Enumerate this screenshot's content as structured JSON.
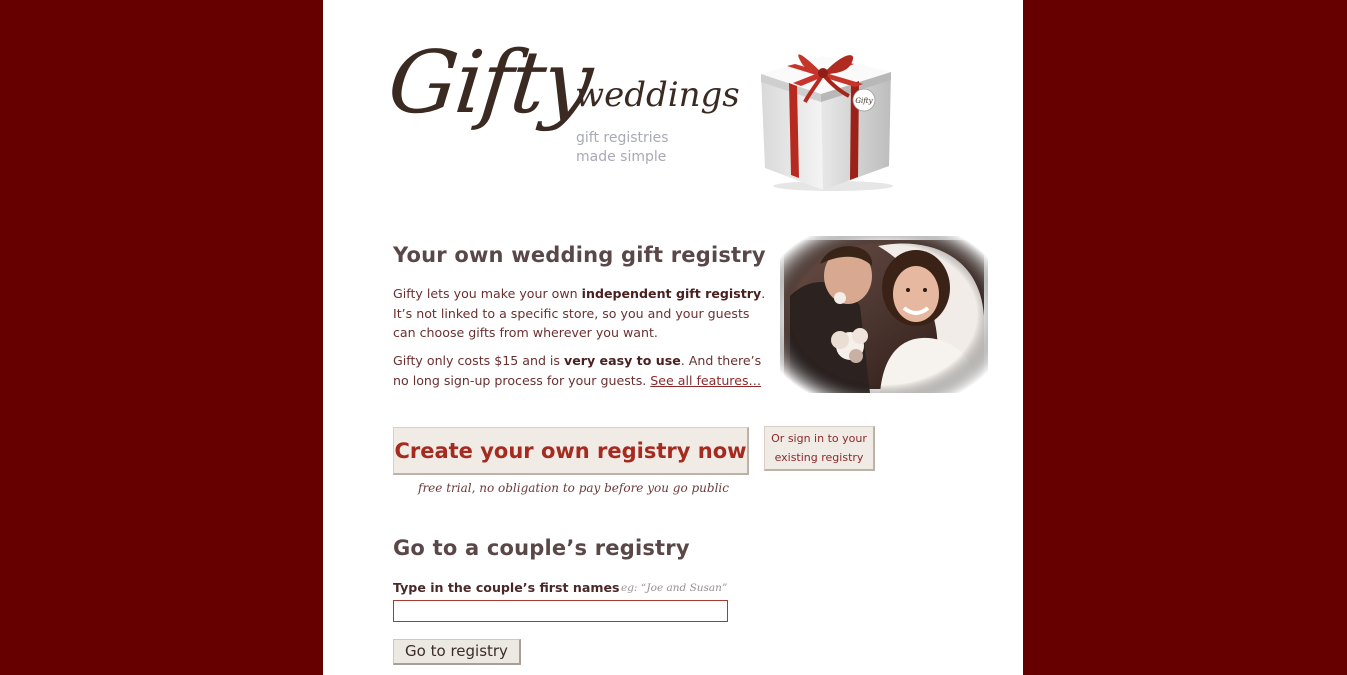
{
  "header": {
    "logo_main": "Gifty",
    "logo_sub": "weddings",
    "tagline": "gift registries\nmade simple",
    "gift_tag_text": "Gifty"
  },
  "intro": {
    "heading": "Your own wedding gift registry",
    "p1_start": "Gifty lets you make your own ",
    "p1_bold": "independent gift registry",
    "p1_end": ". It’s not linked to a specific store, so you and your guests can choose gifts from wherever you want.",
    "p2_start": "Gifty only costs $15 and is ",
    "p2_bold": "very easy to use",
    "p2_end": ". And there’s no long sign-up process for your guests. ",
    "features_link": "See all features…"
  },
  "actions": {
    "create_label": "Create your own registry now",
    "signin_label": "Or sign in to your existing registry",
    "trial_note": "free trial, no obligation to pay before you go public"
  },
  "couple_search": {
    "heading": "Go to a couple’s registry",
    "label": "Type in the couple’s first names",
    "example": "eg: “Joe and Susan”",
    "input_value": "",
    "button_label": "Go to registry"
  },
  "colors": {
    "background": "#660000",
    "accent_red": "#a52a20",
    "heading_text": "#5a4848",
    "tagline_grey": "#a8aab6"
  }
}
